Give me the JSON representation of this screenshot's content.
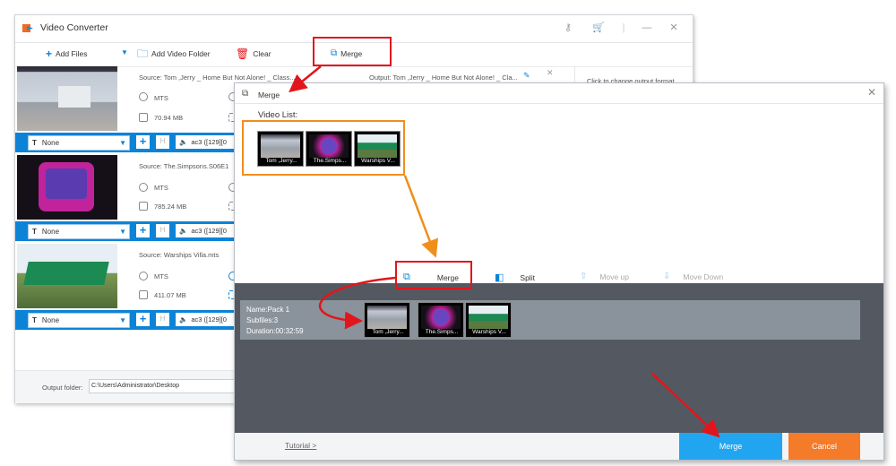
{
  "app": {
    "title": "Video Converter",
    "toolbar": {
      "add_files": "Add Files",
      "add_video_folder": "Add Video Folder",
      "clear": "Clear",
      "merge": "Merge"
    },
    "right_panel_text": "Click to change output format",
    "items": [
      {
        "source": "Source: Tom ,Jerry _ Home But Not Alone! _ Class...",
        "output": "Output: Tom ,Jerry _ Home But Not Alone! _ Cla...",
        "format": "MTS",
        "size": "70.94 MB",
        "subtitle": "None",
        "audio": "ac3 ([129][0"
      },
      {
        "source": "Source: The.Simpsons.S06E1",
        "format": "MTS",
        "size": "785.24 MB",
        "subtitle": "None",
        "audio": "ac3 ([129][0"
      },
      {
        "source": "Source: Warships Villa.mts",
        "format": "MTS",
        "size": "411.07 MB",
        "subtitle": "None",
        "audio": "ac3 ([129][0"
      }
    ],
    "output_folder_label": "Output folder:",
    "output_folder_value": "C:\\Users\\Administrator\\Desktop"
  },
  "dialog": {
    "title": "Merge",
    "video_list_label": "Video List:",
    "videos": [
      "Tom ,Jerry...",
      "The.Simps...",
      "Warships V..."
    ],
    "tools": {
      "merge": "Merge",
      "split": "Split",
      "move_up": "Move up",
      "move_down": "Move Down"
    },
    "pack": {
      "name": "Name:Pack 1",
      "subfiles": "Subfiles:3",
      "duration": "Duration:00:32:59"
    },
    "pack_videos": [
      "Tom ,Jerry...",
      "The.Simps...",
      "Warships V..."
    ],
    "tutorial": "Tutorial >",
    "merge_button": "Merge",
    "cancel_button": "Cancel"
  },
  "colors": {
    "accent_blue": "#0d83d7",
    "merge_button": "#22a5f0",
    "cancel_button": "#f47b2a",
    "highlight_red": "#e1161c",
    "highlight_orange": "#f08e1c",
    "dialog_dark": "#545961"
  }
}
